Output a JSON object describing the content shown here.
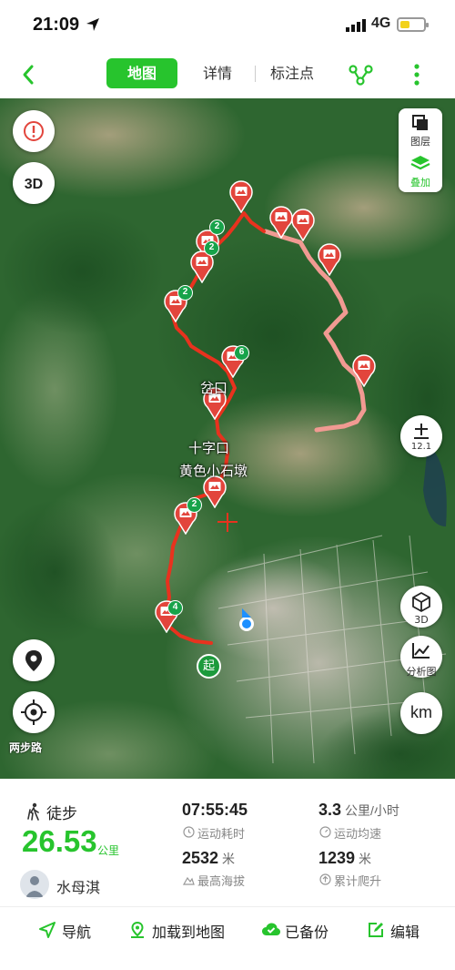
{
  "status_bar": {
    "time": "21:09",
    "network": "4G",
    "battery_level": 0.4
  },
  "nav": {
    "tabs": [
      {
        "label": "地图",
        "active": true
      },
      {
        "label": "详情",
        "active": false
      },
      {
        "label": "标注点",
        "active": false
      }
    ]
  },
  "map": {
    "labels": {
      "fork": "岔口",
      "crossroad": "十字口",
      "stone_pier": "黄色小石墩"
    },
    "photo_counts": [
      "2",
      "2",
      "2",
      "6",
      "2",
      "4"
    ],
    "start_label": "起",
    "layers_label": "图层",
    "overlay_label": "叠加",
    "scale_value": "12.1",
    "three_d_label": "3D",
    "three_d_button": "3D",
    "analysis_label": "分析图",
    "unit_button": "km",
    "brand": "两步路"
  },
  "stats": {
    "sport": "徒步",
    "distance": "26.53",
    "distance_unit": "公里",
    "user_name": "水母淇",
    "duration": {
      "value": "07:55:45",
      "label": "运动耗时"
    },
    "avg_speed": {
      "value": "3.3",
      "unit": "公里/小时",
      "label": "运动均速"
    },
    "max_altitude": {
      "value": "2532",
      "unit": "米",
      "label": "最高海拔"
    },
    "total_climb": {
      "value": "1239",
      "unit": "米",
      "label": "累计爬升"
    }
  },
  "actions": {
    "navigate": "导航",
    "load_to_map": "加载到地图",
    "backed_up": "已备份",
    "edit": "编辑"
  },
  "colors": {
    "accent": "#27c42d",
    "track": "#e8321e",
    "photo_pin": "#e2453c"
  }
}
